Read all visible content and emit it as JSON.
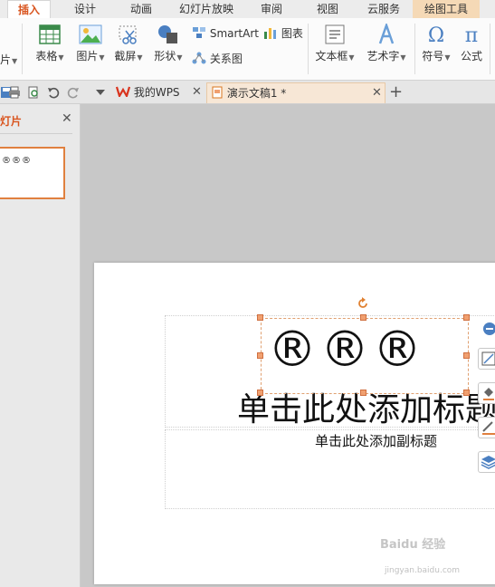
{
  "ribbon_tabs": {
    "insert": "插入",
    "design": "设计",
    "animation": "动画",
    "slideshow": "幻灯片放映",
    "review": "审阅",
    "view": "视图",
    "cloud": "云服务",
    "drawing_tools": "绘图工具"
  },
  "ribbon": {
    "partial_left": "片",
    "table": "表格",
    "picture": "图片",
    "screenshot": "截屏",
    "shapes": "形状",
    "smartart": "SmartArt",
    "chart": "图表",
    "relation": "关系图",
    "textbox": "文本框",
    "wordart": "艺术字",
    "symbol": "符号",
    "formula": "公式"
  },
  "doc_tabs": {
    "my_wps": "我的WPS",
    "document": "演示文稿1 *"
  },
  "left_panel": {
    "title": "灯片",
    "thumb_text": "®®®"
  },
  "slide": {
    "symbols": "®®®",
    "title_placeholder": "单击此处添加标题",
    "subtitle_placeholder": "单击此处添加副标题"
  },
  "watermark": {
    "brand": "Baidu 经验",
    "url": "jingyan.baidu.com"
  },
  "colors": {
    "accent": "#d9541e",
    "selection": "#f0a070",
    "ribbon_bg": "#fbfbfb",
    "tool_tab": "#f5d9b6"
  },
  "icons": {
    "table": "table-icon",
    "picture": "picture-icon",
    "screenshot": "scissors-icon",
    "shapes": "shapes-icon",
    "smartart": "smartart-icon",
    "chart": "bar-chart-icon",
    "relation": "relation-icon",
    "textbox": "textbox-icon",
    "wordart": "wordart-icon",
    "symbol": "omega-icon",
    "formula": "pi-icon"
  }
}
